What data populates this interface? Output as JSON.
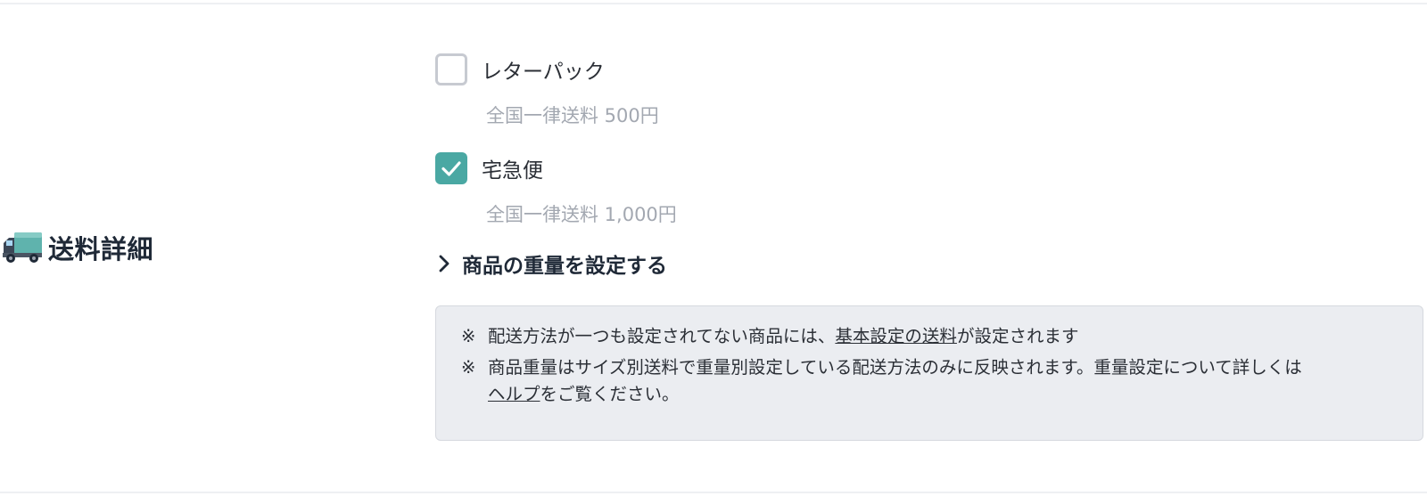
{
  "section": {
    "icon": "truck-icon",
    "title": "送料詳細"
  },
  "options": [
    {
      "label": "レターパック",
      "note": "全国一律送料 500円",
      "checked": false
    },
    {
      "label": "宅急便",
      "note": "全国一律送料 1,000円",
      "checked": true
    }
  ],
  "weight_toggle": {
    "icon": "chevron-right-icon",
    "label": "商品の重量を設定する"
  },
  "info": {
    "mark": "※",
    "note1": {
      "before": "配送方法が一つも設定されてない商品には、",
      "link": "基本設定の送料",
      "after": "が設定されます"
    },
    "note2": {
      "before": "商品重量はサイズ別送料で重量別設定している配送方法のみに反映されます。重量設定について詳しくは",
      "link": "ヘルプ",
      "after": "をご覧ください。"
    }
  },
  "colors": {
    "accent": "#4aa8a3",
    "muted_text": "#a3a8b1",
    "info_bg": "#ebedf1"
  }
}
